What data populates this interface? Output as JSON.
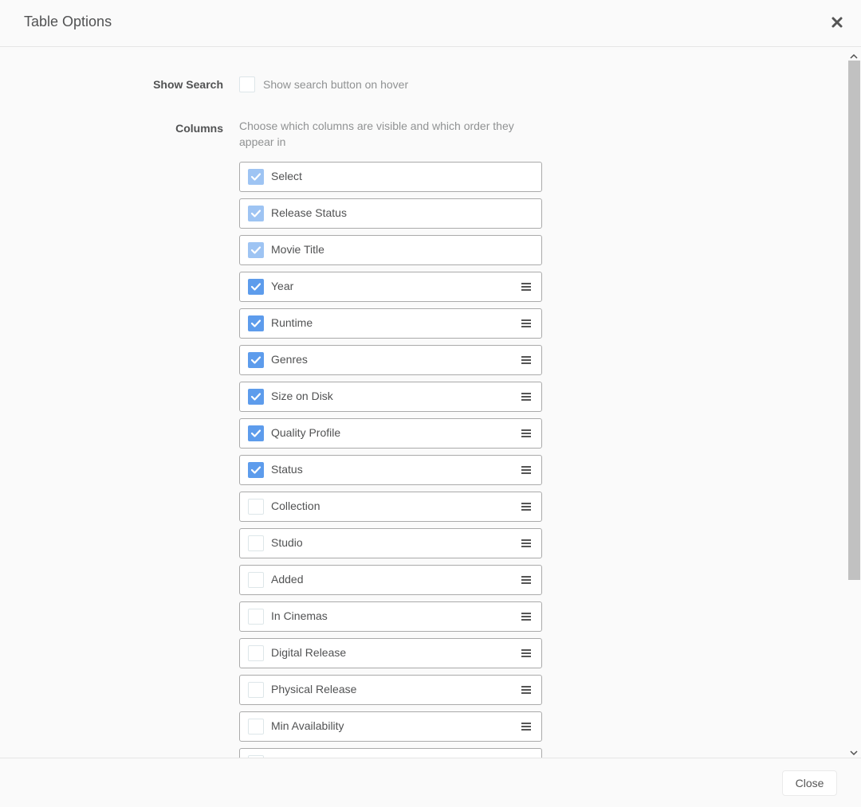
{
  "modal": {
    "title": "Table Options",
    "close_icon": "close-icon"
  },
  "show_search": {
    "label": "Show Search",
    "checked": false,
    "help": "Show search button on hover"
  },
  "columns": {
    "label": "Columns",
    "help": "Choose which columns are visible and which order they appear in",
    "items": [
      {
        "label": "Select",
        "checked": true,
        "locked": true
      },
      {
        "label": "Release Status",
        "checked": true,
        "locked": true
      },
      {
        "label": "Movie Title",
        "checked": true,
        "locked": true
      },
      {
        "label": "Year",
        "checked": true,
        "locked": false
      },
      {
        "label": "Runtime",
        "checked": true,
        "locked": false
      },
      {
        "label": "Genres",
        "checked": true,
        "locked": false
      },
      {
        "label": "Size on Disk",
        "checked": true,
        "locked": false
      },
      {
        "label": "Quality Profile",
        "checked": true,
        "locked": false
      },
      {
        "label": "Status",
        "checked": true,
        "locked": false
      },
      {
        "label": "Collection",
        "checked": false,
        "locked": false
      },
      {
        "label": "Studio",
        "checked": false,
        "locked": false
      },
      {
        "label": "Added",
        "checked": false,
        "locked": false
      },
      {
        "label": "In Cinemas",
        "checked": false,
        "locked": false
      },
      {
        "label": "Digital Release",
        "checked": false,
        "locked": false
      },
      {
        "label": "Physical Release",
        "checked": false,
        "locked": false
      },
      {
        "label": "Min Availability",
        "checked": false,
        "locked": false
      },
      {
        "label": "",
        "checked": false,
        "locked": false
      }
    ]
  },
  "footer": {
    "close_label": "Close"
  },
  "colors": {
    "accent": "#5d9cec",
    "accent_disabled": "#9ec4f3",
    "border": "#aaaaaa"
  }
}
